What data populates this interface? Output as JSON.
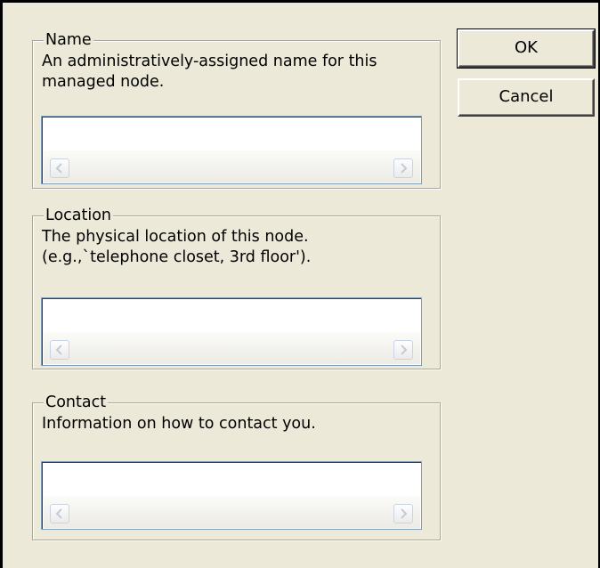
{
  "groups": {
    "name": {
      "title": "Name",
      "description_lines": [
        "An administratively-assigned name for this",
        "managed node."
      ],
      "value": ""
    },
    "location": {
      "title": "Location",
      "description_lines": [
        "The physical location of this node.",
        "(e.g.,`telephone closet, 3rd floor')."
      ],
      "value": ""
    },
    "contact": {
      "title": "Contact",
      "description_lines": [
        "Information on how to contact you."
      ],
      "value": ""
    }
  },
  "buttons": {
    "ok_label": "OK",
    "cancel_label": "Cancel"
  },
  "icons": {
    "scroll_left": "scroll-left-arrow-icon",
    "scroll_right": "scroll-right-arrow-icon"
  },
  "colors": {
    "dialog_background": "#ece9d8",
    "field_border": "#7f9db9",
    "arrow_color": "#c4cbd6"
  }
}
